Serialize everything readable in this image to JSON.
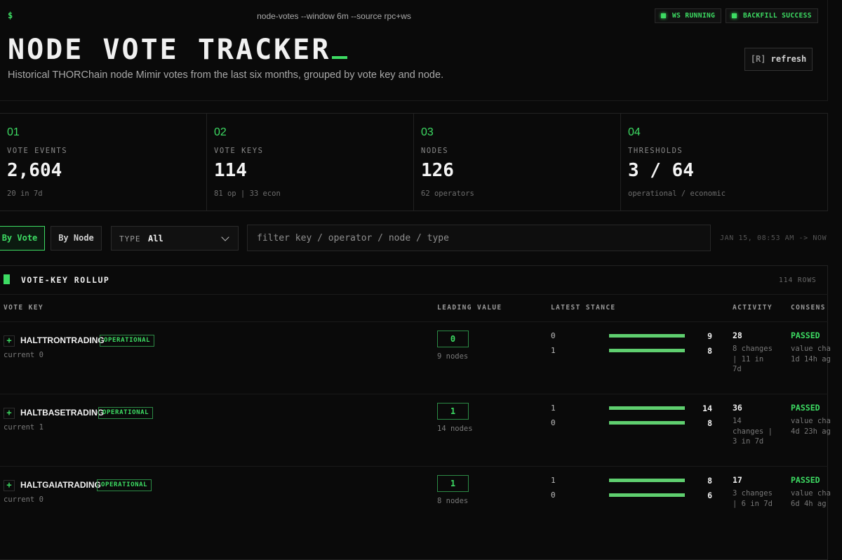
{
  "topbar": {
    "prompt": "$",
    "command": "node-votes --window 6m --source rpc+ws",
    "ws_status": "WS RUNNING",
    "backfill_status": "BACKFILL SUCCESS"
  },
  "header": {
    "title": "NODE VOTE TRACKER",
    "subtitle": "Historical THORChain node Mimir votes from the last six months, grouped by vote key and node.",
    "refresh_key": "[R]",
    "refresh_label": "refresh"
  },
  "stats": [
    {
      "index": "01",
      "label": "VOTE EVENTS",
      "value": "2,604",
      "sub": "20 in 7d"
    },
    {
      "index": "02",
      "label": "VOTE KEYS",
      "value": "114",
      "sub": "81 op | 33 econ"
    },
    {
      "index": "03",
      "label": "NODES",
      "value": "126",
      "sub": "62 operators"
    },
    {
      "index": "04",
      "label": "THRESHOLDS",
      "value": "3 / 64",
      "sub": "operational / economic"
    }
  ],
  "controls": {
    "tab_vote": "By Vote",
    "tab_node": "By Node",
    "type_label": "TYPE",
    "type_value": "All",
    "filter_placeholder": "filter key / operator / node / type",
    "time_range": "JAN 15, 08:53 AM -> NOW"
  },
  "table": {
    "title": "VOTE-KEY ROLLUP",
    "row_count": "114 ROWS",
    "columns": {
      "vote_key": "VOTE KEY",
      "leading_value": "LEADING VALUE",
      "latest_stance": "LATEST STANCE",
      "activity": "ACTIVITY",
      "consensus": "CONSENS"
    },
    "rows": [
      {
        "key": "HALTTRONTRADING",
        "type": "OPERATIONAL",
        "current": "current 0",
        "leading": "0",
        "nodes": "9 nodes",
        "stance": [
          {
            "value": "0",
            "count": "9",
            "share": 1.0
          },
          {
            "value": "1",
            "count": "8",
            "share": 1.0
          }
        ],
        "activity": "28",
        "activity_detail": "8 changes | 11 in 7d",
        "consensus": "PASSED",
        "consensus_line1": "value cha",
        "consensus_line2": "1d 14h ag"
      },
      {
        "key": "HALTBASETRADING",
        "type": "OPERATIONAL",
        "current": "current 1",
        "leading": "1",
        "nodes": "14 nodes",
        "stance": [
          {
            "value": "1",
            "count": "14",
            "share": 1.0
          },
          {
            "value": "0",
            "count": "8",
            "share": 1.0
          }
        ],
        "activity": "36",
        "activity_detail": "14 changes | 3 in 7d",
        "consensus": "PASSED",
        "consensus_line1": "value cha",
        "consensus_line2": "4d 23h ag"
      },
      {
        "key": "HALTGAIATRADING",
        "type": "OPERATIONAL",
        "current": "current 0",
        "leading": "1",
        "nodes": "8 nodes",
        "stance": [
          {
            "value": "1",
            "count": "8",
            "share": 1.0
          },
          {
            "value": "0",
            "count": "6",
            "share": 1.0
          }
        ],
        "activity": "17",
        "activity_detail": "3 changes | 6 in 7d",
        "consensus": "PASSED",
        "consensus_line1": "value cha",
        "consensus_line2": "6d 4h ag"
      }
    ]
  },
  "colors": {
    "accent": "#3ddc63",
    "background": "#0a0a0a"
  }
}
